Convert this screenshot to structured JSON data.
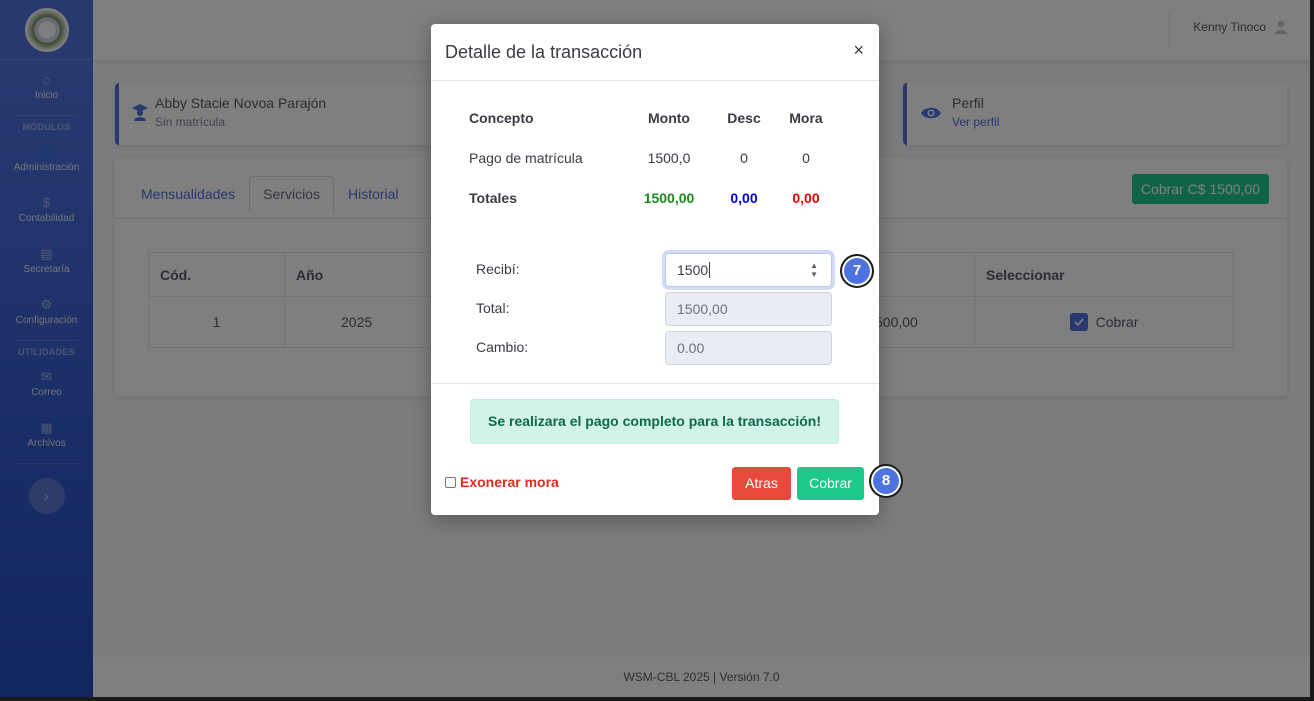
{
  "sidebar": {
    "items": [
      {
        "label": "Inicio",
        "icon": "home-icon",
        "glyph": "⌂"
      },
      {
        "label": "Administración",
        "icon": "users-cog-icon",
        "glyph": "👤"
      },
      {
        "label": "Contabilidad",
        "icon": "dollar-icon",
        "glyph": "$"
      },
      {
        "label": "Secretaría",
        "icon": "book-icon",
        "glyph": "▤"
      },
      {
        "label": "Configuración",
        "icon": "gear-icon",
        "glyph": "⚙"
      },
      {
        "label": "Correo",
        "icon": "envelope-icon",
        "glyph": "✉"
      },
      {
        "label": "Archivos",
        "icon": "archive-icon",
        "glyph": "▦"
      }
    ],
    "headings": {
      "modules": "MÓDULOS",
      "utilities": "UTILIDADES"
    },
    "toggle_glyph": "›"
  },
  "topbar": {
    "user_name": "Kenny Tinoco"
  },
  "student_card": {
    "name": "Abby Stacie Novoa Parajón",
    "status": "Sin matrícula"
  },
  "profile_card": {
    "title": "Perfil",
    "link": "Ver perfil"
  },
  "tabs": [
    {
      "label": "Mensualidades",
      "active": false
    },
    {
      "label": "Servicios",
      "active": true
    },
    {
      "label": "Historial",
      "active": false
    }
  ],
  "charge_button": "Cobrar C$ 1500,00",
  "services_table": {
    "headers": [
      "Cód.",
      "Año",
      "Seleccionar"
    ],
    "row": {
      "code": "1",
      "year": "2025",
      "amount_partial": "500,00",
      "select_label": "Cobrar"
    }
  },
  "modal": {
    "title": "Detalle de la transacción",
    "close": "×",
    "headers": [
      "Concepto",
      "Monto",
      "Desc",
      "Mora"
    ],
    "rows": [
      {
        "concept": "Pago de matrícula",
        "amount": "1500,0",
        "discount": "0",
        "late": "0"
      }
    ],
    "totals": {
      "label": "Totales",
      "amount": "1500,00",
      "discount": "0,00",
      "late": "0,00"
    },
    "form": {
      "received_label": "Recibí:",
      "received_value": "1500",
      "total_label": "Total:",
      "total_value": "1500,00",
      "change_label": "Cambio:",
      "change_value": "0.00"
    },
    "alert": "Se realizara el pago completo para la transacción!",
    "exonerate_label": "Exonerar mora",
    "back_button": "Atras",
    "charge_button": "Cobrar"
  },
  "markers": [
    "7",
    "8"
  ],
  "footer": "WSM-CBL 2025 | Versión 7.0",
  "colors": {
    "primary": "#4e73df",
    "success": "#1cc88a",
    "danger": "#e74a3b",
    "total_green": "#1a8a1a",
    "total_blue": "#0000ee",
    "total_red": "#ee0000"
  }
}
